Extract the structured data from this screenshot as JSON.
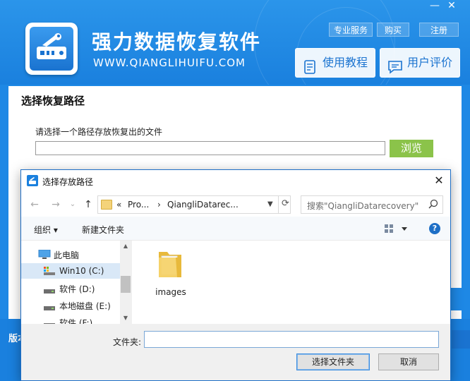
{
  "app": {
    "title": "强力数据恢复软件",
    "url": "WWW.QIANGLIHUIFU.COM",
    "window_controls": {
      "minimize": "—",
      "close": "✕"
    },
    "top_links": [
      "专业服务",
      "购买",
      "注册"
    ],
    "buttons": {
      "tutorial": "使用教程",
      "reviews": "用户评价"
    },
    "section_title": "选择恢复路径",
    "path_label": "请选择一个路径存放恢复出的文件",
    "path_value": "",
    "browse": "浏览",
    "footer_text": "版本",
    "colors": {
      "header": "#1a80de",
      "browse": "#8bc34a"
    }
  },
  "dialog": {
    "title": "选择存放路径",
    "close": "✕",
    "nav": {
      "back": "←",
      "forward": "→",
      "recent": "⌄",
      "up": "↑"
    },
    "address": {
      "prefix": "«",
      "seg1": "Pro...",
      "sep": "›",
      "seg2": "QiangliDatarec..."
    },
    "search_placeholder": "搜索\"QiangliDatarecovery\"",
    "toolbar": {
      "organize": "组织 ▾",
      "new_folder": "新建文件夹"
    },
    "nav_items": [
      {
        "label": "此电脑",
        "icon": "computer-icon",
        "selected": false
      },
      {
        "label": "Win10 (C:)",
        "icon": "system-drive-icon",
        "selected": true
      },
      {
        "label": "软件 (D:)",
        "icon": "drive-icon",
        "selected": false
      },
      {
        "label": "本地磁盘 (E:)",
        "icon": "drive-icon",
        "selected": false
      },
      {
        "label": "软件 (F:)",
        "icon": "drive-icon",
        "selected": false
      }
    ],
    "files": [
      {
        "label": "images",
        "icon": "folder-icon"
      }
    ],
    "folder_label": "文件夹:",
    "folder_value": "",
    "select_button": "选择文件夹",
    "cancel_button": "取消"
  }
}
